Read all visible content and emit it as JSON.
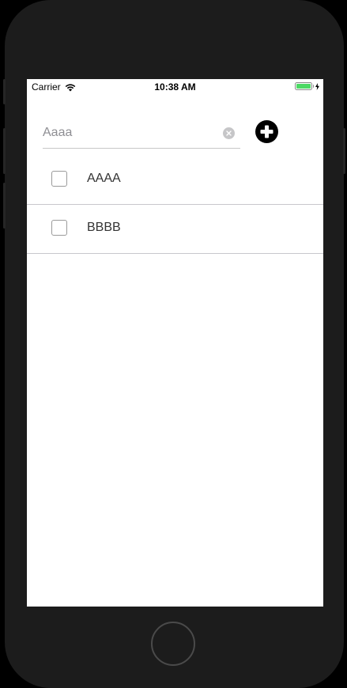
{
  "status_bar": {
    "carrier": "Carrier",
    "time": "10:38 AM",
    "battery_color": "#4cd964"
  },
  "input": {
    "value": "",
    "placeholder": "Aaaa",
    "clear_icon": "clear-circle-icon"
  },
  "add_button": {
    "icon": "plus-circle-icon"
  },
  "todo_list": {
    "items": [
      {
        "label": "AAAA",
        "checked": false
      },
      {
        "label": "BBBB",
        "checked": false
      }
    ]
  }
}
